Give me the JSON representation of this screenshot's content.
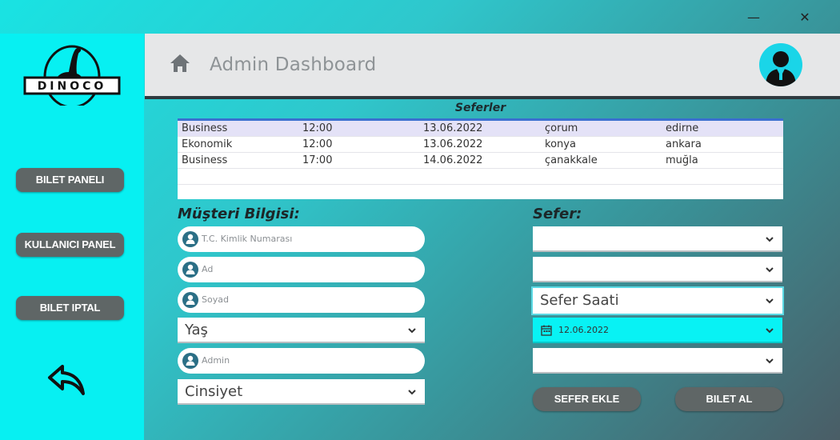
{
  "window": {
    "minimize_label": "—",
    "close_label": "✕"
  },
  "logo": {
    "text": "DINOCO"
  },
  "sidebar": {
    "buttons": [
      {
        "label": "BILET PANELI"
      },
      {
        "label": "KULLANICI PANEL"
      },
      {
        "label": "BILET IPTAL"
      }
    ],
    "back_icon": "undo-arrow-icon"
  },
  "header": {
    "title": "Admin Dashboard",
    "home_icon": "home-icon",
    "avatar_icon": "admin-avatar-icon"
  },
  "trips_table": {
    "title": "Seferler",
    "rows": [
      [
        "Business",
        "12:00",
        "13.06.2022",
        "çorum",
        "edirne"
      ],
      [
        "Ekonomik",
        "12:00",
        "13.06.2022",
        "konya",
        "ankara"
      ],
      [
        "Business",
        "17:00",
        "14.06.2022",
        "çanakkale",
        "muğla"
      ]
    ]
  },
  "customer": {
    "label": "Müşteri Bilgisi:",
    "tc_placeholder": "T.C. Kimlik Numarası",
    "first_name_placeholder": "Ad",
    "last_name_placeholder": "Soyad",
    "age_select": "Yaş",
    "username_value": "Admin",
    "gender_select": "Cinsiyet"
  },
  "trip": {
    "label": "Sefer:",
    "select_1": "",
    "select_2": "",
    "time_select": "Sefer Saati",
    "date_value": "12.06.2022",
    "select_5": ""
  },
  "actions": {
    "add_trip": "SEFER EKLE",
    "buy_ticket": "BILET AL"
  },
  "colors": {
    "sidebar": "#07f0f2",
    "button": "#5f6666",
    "accent": "#08f2f4",
    "table_header_line": "#3b6fd0"
  }
}
